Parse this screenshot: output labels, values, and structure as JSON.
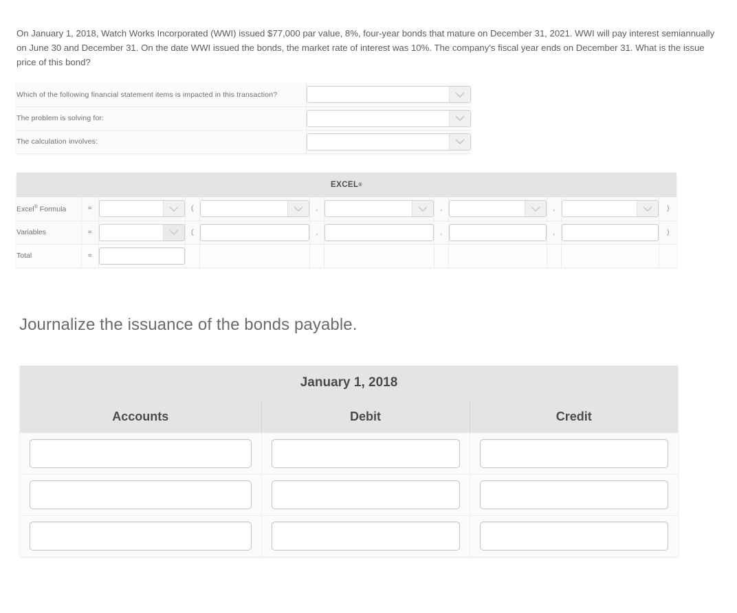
{
  "problem": {
    "text": "On January 1, 2018, Watch Works Incorporated (WWI) issued $77,000 par value, 8%, four-year bonds that mature on December 31, 2021. WWI will pay interest semiannually on June 30 and December 31. On the date WWI issued the bonds, the market rate of interest was 10%. The company's fiscal year ends on December 31. What is the issue price of this bond?"
  },
  "question_table": {
    "rows": [
      {
        "label": "Which of the following financial statement items is impacted in this transaction?",
        "value": "",
        "control": "dropdown"
      },
      {
        "label": "The problem is solving for:",
        "value": "",
        "control": "dropdown"
      },
      {
        "label": "The calculation involves:",
        "value": "",
        "control": "dropdown"
      }
    ]
  },
  "excel_table": {
    "header": "EXCEL",
    "header_superscript": "®",
    "rows": [
      {
        "label": "Excel",
        "label_superscript": "®",
        "label_rest": " Formula",
        "equals": "=",
        "open_paren": "(",
        "separator": ",",
        "close_paren": ")",
        "fields": [
          "",
          "",
          "",
          "",
          ""
        ]
      },
      {
        "label": "Variables",
        "label_superscript": "",
        "label_rest": "",
        "equals": "=",
        "open_paren": "(",
        "separator": ",",
        "close_paren": ")",
        "fields": [
          "",
          "",
          "",
          "",
          ""
        ]
      },
      {
        "label": "Total",
        "label_superscript": "",
        "label_rest": "",
        "equals": "=",
        "open_paren": "",
        "separator": "",
        "close_paren": "",
        "fields": [
          "",
          "",
          "",
          "",
          ""
        ]
      }
    ]
  },
  "journalize": {
    "heading": "Journalize the issuance of the bonds payable.",
    "date": "January 1, 2018",
    "columns": [
      "Accounts",
      "Debit",
      "Credit"
    ],
    "rows": [
      {
        "accounts": "",
        "debit": "",
        "credit": ""
      },
      {
        "accounts": "",
        "debit": "",
        "credit": ""
      },
      {
        "accounts": "",
        "debit": "",
        "credit": ""
      }
    ]
  },
  "colors": {
    "header_bg": "#e4e4e4",
    "body_bg": "#fbfbfb",
    "text": "#58595b",
    "border": "#ececec"
  }
}
